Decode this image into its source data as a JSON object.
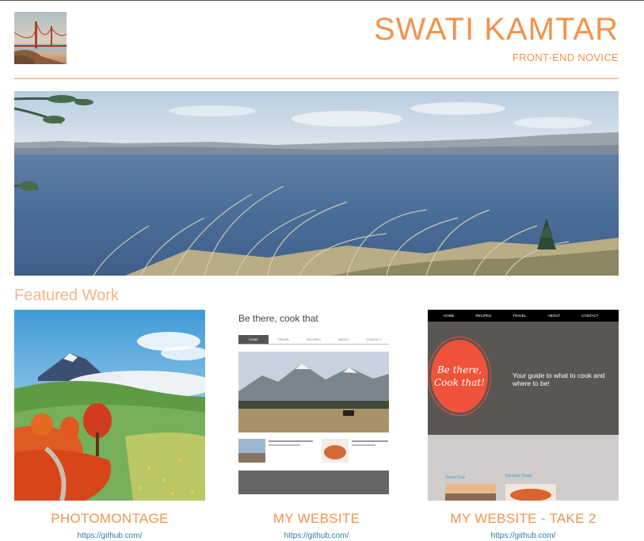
{
  "header": {
    "title": "SWATI KAMTAR",
    "subtitle": "FRONT-END NOVICE",
    "accent_color": "#f5924b"
  },
  "featured": {
    "heading": "Featured Work"
  },
  "projects": [
    {
      "title": "PHOTOMONTAGE",
      "link": "https://github.com/"
    },
    {
      "title": "MY WEBSITE",
      "link": "https://github.com/",
      "preview": {
        "site_title": "Be there, cook that",
        "nav": [
          "HOME",
          "TRAVEL",
          "RECIPES",
          "ABOUT",
          "CONTACT"
        ]
      }
    },
    {
      "title": "MY WEBSITE - TAKE 2",
      "link": "https://github.com/",
      "preview": {
        "nav": [
          "HOME",
          "RECIPES",
          "TRAVEL",
          "ABOUT",
          "CONTACT"
        ],
        "logo_line1": "Be there,",
        "logo_line2": "Cook that!",
        "tagline": "Your guide to what to cook and where to be!",
        "cards": [
          "Santa Cruz",
          "Samosa Chaat"
        ]
      }
    }
  ]
}
